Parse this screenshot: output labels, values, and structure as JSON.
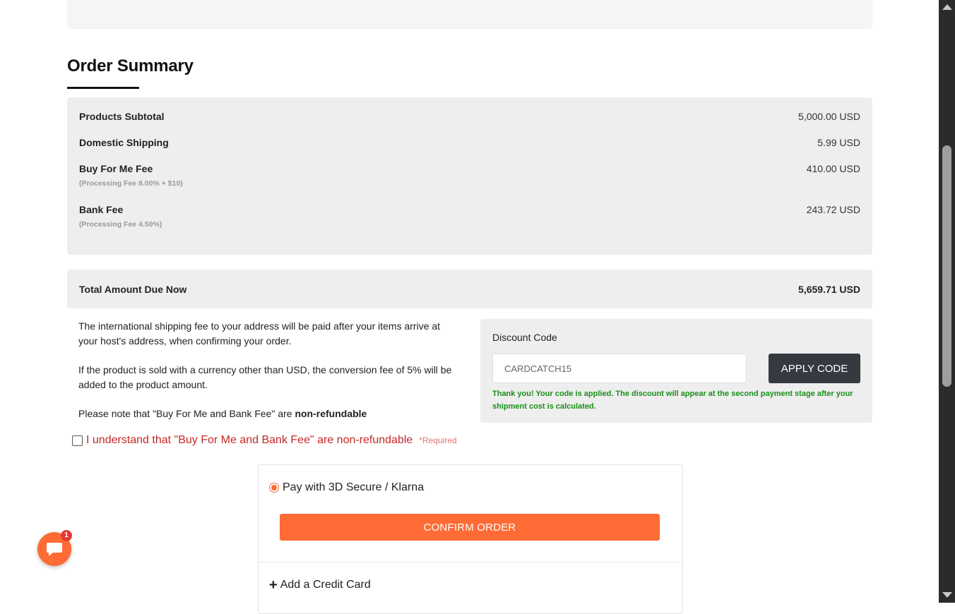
{
  "summary": {
    "title": "Order Summary",
    "rows": [
      {
        "label": "Products Subtotal",
        "value": "5,000.00 USD"
      },
      {
        "label": "Domestic Shipping",
        "value": "5.99 USD"
      },
      {
        "label": "Buy For Me Fee",
        "value": "410.00 USD",
        "note": "(Processing Fee 8.00% + $10)"
      },
      {
        "label": "Bank Fee",
        "value": "243.72 USD",
        "note": "(Processing Fee 4.50%)"
      }
    ],
    "total_label": "Total Amount Due Now",
    "total_value": "5,659.71 USD"
  },
  "notes": {
    "p1": "The international shipping fee to your address will be paid after your items arrive at your host's address, when confirming your order.",
    "p2": "If the product is sold with a currency other than USD, the conversion fee of 5% will be added to the product amount.",
    "p3_prefix": "Please note that \"Buy For Me and Bank Fee\" are ",
    "p3_bold": "non-refundable"
  },
  "agreement": {
    "label": "I understand that \"Buy For Me and Bank Fee\" are non-refundable",
    "required": "*Required",
    "checked": false
  },
  "discount": {
    "label": "Discount Code",
    "value": "CARDCATCH15",
    "button": "APPLY CODE",
    "message": "Thank you! Your code is applied. The discount will appear at the second payment stage after your shipment cost is calculated."
  },
  "payment": {
    "option_label": "Pay with 3D Secure / Klarna",
    "confirm_label": "CONFIRM ORDER",
    "add_card_label": "Add a Credit Card"
  },
  "chat": {
    "badge": "1"
  },
  "colors": {
    "accent": "#ff6b35",
    "success": "#1a8f1a",
    "warning": "#c62828",
    "dark_button": "#343a40"
  }
}
